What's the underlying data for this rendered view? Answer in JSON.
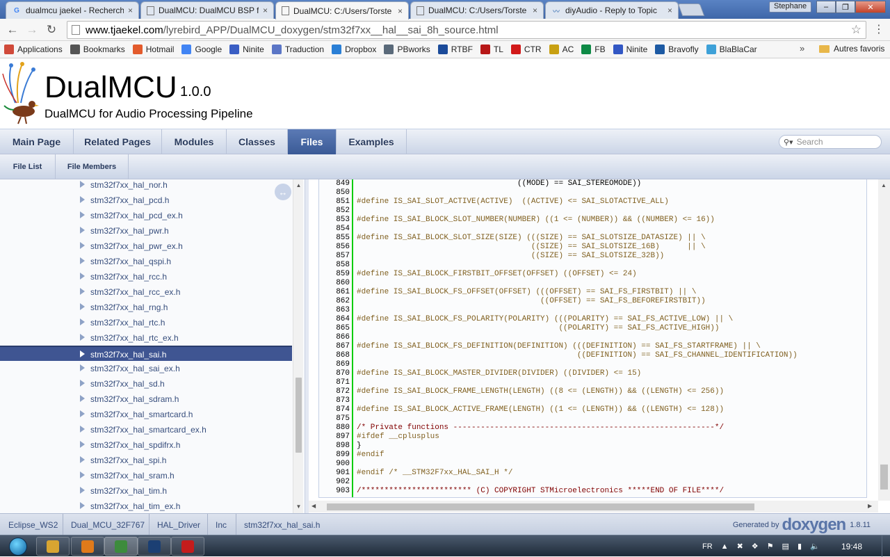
{
  "browser": {
    "tabs": [
      {
        "title": "dualmcu jaekel - Recherch",
        "favicon": "google-icon"
      },
      {
        "title": "DualMCU: DualMCU BSP f",
        "favicon": "page-icon"
      },
      {
        "title": "DualMCU: C:/Users/Torste",
        "favicon": "page-icon",
        "active": true
      },
      {
        "title": "DualMCU: C:/Users/Torste",
        "favicon": "page-icon"
      },
      {
        "title": "diyAudio - Reply to Topic",
        "favicon": "diyaudio-icon"
      }
    ],
    "user": "Stephane",
    "url_host": "www.tjaekel.com",
    "url_path": "/lyrebird_APP/DualMCU_doxygen/stm32f7xx__hal__sai_8h_source.html",
    "bookmarks": [
      {
        "label": "Applications",
        "icon": "apps-grid-icon",
        "color": "#d04a3a"
      },
      {
        "label": "Bookmarks",
        "icon": "star-icon",
        "color": "#555555"
      },
      {
        "label": "Hotmail",
        "icon": "windows-icon",
        "color": "#e35b2c"
      },
      {
        "label": "Google",
        "icon": "google-icon",
        "color": "#4285f4"
      },
      {
        "label": "Ninite",
        "icon": "ninite-icon",
        "color": "#3a5ec4"
      },
      {
        "label": "Traduction",
        "icon": "translate-icon",
        "color": "#5b76c6"
      },
      {
        "label": "Dropbox",
        "icon": "dropbox-icon",
        "color": "#2a7fd6"
      },
      {
        "label": "PBworks",
        "icon": "pb-icon",
        "color": "#5a6a7a"
      },
      {
        "label": "RTBF",
        "icon": "rtbf-icon",
        "color": "#1b4b9a"
      },
      {
        "label": "TL",
        "icon": "tl-icon",
        "color": "#b71818"
      },
      {
        "label": "CTR",
        "icon": "ctr-icon",
        "color": "#d11919"
      },
      {
        "label": "AC",
        "icon": "ac-icon",
        "color": "#c8a012"
      },
      {
        "label": "FB",
        "icon": "fb-icon",
        "color": "#0e8a46"
      },
      {
        "label": "Ninite",
        "icon": "n-icon",
        "color": "#3257c4"
      },
      {
        "label": "Bravofly",
        "icon": "bravofly-icon",
        "color": "#1d5aa3"
      },
      {
        "label": "BlaBlaCar",
        "icon": "blablacar-icon",
        "color": "#3ea1d8"
      }
    ],
    "bookmarks_more": "»",
    "other_bookmarks": "Autres favoris"
  },
  "header": {
    "project_name": "DualMCU",
    "project_version": "1.0.0",
    "project_brief": "DualMCU for Audio Processing Pipeline"
  },
  "main_tabs": [
    {
      "label": "Main Page"
    },
    {
      "label": "Related Pages"
    },
    {
      "label": "Modules"
    },
    {
      "label": "Classes"
    },
    {
      "label": "Files",
      "current": true
    },
    {
      "label": "Examples"
    }
  ],
  "search": {
    "placeholder": "Search"
  },
  "sub_tabs": [
    {
      "label": "File List"
    },
    {
      "label": "File Members"
    }
  ],
  "tree": [
    "stm32f7xx_hal_nor.h",
    "stm32f7xx_hal_pcd.h",
    "stm32f7xx_hal_pcd_ex.h",
    "stm32f7xx_hal_pwr.h",
    "stm32f7xx_hal_pwr_ex.h",
    "stm32f7xx_hal_qspi.h",
    "stm32f7xx_hal_rcc.h",
    "stm32f7xx_hal_rcc_ex.h",
    "stm32f7xx_hal_rng.h",
    "stm32f7xx_hal_rtc.h",
    "stm32f7xx_hal_rtc_ex.h",
    "stm32f7xx_hal_sai.h",
    "stm32f7xx_hal_sai_ex.h",
    "stm32f7xx_hal_sd.h",
    "stm32f7xx_hal_sdram.h",
    "stm32f7xx_hal_smartcard.h",
    "stm32f7xx_hal_smartcard_ex.h",
    "stm32f7xx_hal_spdifrx.h",
    "stm32f7xx_hal_spi.h",
    "stm32f7xx_hal_sram.h",
    "stm32f7xx_hal_tim.h",
    "stm32f7xx_hal_tim_ex.h"
  ],
  "tree_selected": "stm32f7xx_hal_sai.h",
  "code": [
    {
      "n": "849",
      "t": "                                   ((MODE) == SAI_STEREOMODE))",
      "k": ""
    },
    {
      "n": "850",
      "t": "",
      "k": ""
    },
    {
      "n": "851",
      "t": "#define IS_SAI_SLOT_ACTIVE(ACTIVE)  ((ACTIVE) <= SAI_SLOTACTIVE_ALL)",
      "k": "pp"
    },
    {
      "n": "852",
      "t": "",
      "k": ""
    },
    {
      "n": "853",
      "t": "#define IS_SAI_BLOCK_SLOT_NUMBER(NUMBER) ((1 <= (NUMBER)) && ((NUMBER) <= 16))",
      "k": "pp"
    },
    {
      "n": "854",
      "t": "",
      "k": ""
    },
    {
      "n": "855",
      "t": "#define IS_SAI_BLOCK_SLOT_SIZE(SIZE) (((SIZE) == SAI_SLOTSIZE_DATASIZE) || \\",
      "k": "pp"
    },
    {
      "n": "856",
      "t": "                                      ((SIZE) == SAI_SLOTSIZE_16B)      || \\",
      "k": "pp"
    },
    {
      "n": "857",
      "t": "                                      ((SIZE) == SAI_SLOTSIZE_32B))",
      "k": "pp"
    },
    {
      "n": "858",
      "t": "",
      "k": ""
    },
    {
      "n": "859",
      "t": "#define IS_SAI_BLOCK_FIRSTBIT_OFFSET(OFFSET) ((OFFSET) <= 24)",
      "k": "pp"
    },
    {
      "n": "860",
      "t": "",
      "k": ""
    },
    {
      "n": "861",
      "t": "#define IS_SAI_BLOCK_FS_OFFSET(OFFSET) (((OFFSET) == SAI_FS_FIRSTBIT) || \\",
      "k": "pp"
    },
    {
      "n": "862",
      "t": "                                        ((OFFSET) == SAI_FS_BEFOREFIRSTBIT))",
      "k": "pp"
    },
    {
      "n": "863",
      "t": "",
      "k": ""
    },
    {
      "n": "864",
      "t": "#define IS_SAI_BLOCK_FS_POLARITY(POLARITY) (((POLARITY) == SAI_FS_ACTIVE_LOW) || \\",
      "k": "pp"
    },
    {
      "n": "865",
      "t": "                                            ((POLARITY) == SAI_FS_ACTIVE_HIGH))",
      "k": "pp"
    },
    {
      "n": "866",
      "t": "",
      "k": ""
    },
    {
      "n": "867",
      "t": "#define IS_SAI_BLOCK_FS_DEFINITION(DEFINITION) (((DEFINITION) == SAI_FS_STARTFRAME) || \\",
      "k": "pp"
    },
    {
      "n": "868",
      "t": "                                                ((DEFINITION) == SAI_FS_CHANNEL_IDENTIFICATION))",
      "k": "pp"
    },
    {
      "n": "869",
      "t": "",
      "k": ""
    },
    {
      "n": "870",
      "t": "#define IS_SAI_BLOCK_MASTER_DIVIDER(DIVIDER) ((DIVIDER) <= 15)",
      "k": "pp"
    },
    {
      "n": "871",
      "t": "",
      "k": ""
    },
    {
      "n": "872",
      "t": "#define IS_SAI_BLOCK_FRAME_LENGTH(LENGTH) ((8 <= (LENGTH)) && ((LENGTH) <= 256))",
      "k": "pp"
    },
    {
      "n": "873",
      "t": "",
      "k": ""
    },
    {
      "n": "874",
      "t": "#define IS_SAI_BLOCK_ACTIVE_FRAME(LENGTH) ((1 <= (LENGTH)) && ((LENGTH) <= 128))",
      "k": "pp"
    },
    {
      "n": "875",
      "t": "",
      "k": ""
    },
    {
      "n": "880",
      "t": "/* Private functions ---------------------------------------------------------*/",
      "k": "cm"
    },
    {
      "n": "897",
      "t": "#ifdef __cplusplus",
      "k": "pp"
    },
    {
      "n": "898",
      "t": "}",
      "k": ""
    },
    {
      "n": "899",
      "t": "#endif",
      "k": "pp"
    },
    {
      "n": "900",
      "t": "",
      "k": ""
    },
    {
      "n": "901",
      "t": "#endif /* __STM32F7xx_HAL_SAI_H */",
      "k": "mix"
    },
    {
      "n": "902",
      "t": "",
      "k": ""
    },
    {
      "n": "903",
      "t": "/************************ (C) COPYRIGHT STMicroelectronics *****END OF FILE****/",
      "k": "cm"
    }
  ],
  "navpath": [
    "Eclipse_WS2",
    "Dual_MCU_32F767",
    "HAL_Driver",
    "Inc",
    "stm32f7xx_hal_sai.h"
  ],
  "footer": {
    "generated_by": "Generated by",
    "doxygen": "doxygen",
    "version": "1.8.11"
  },
  "taskbar": {
    "apps": [
      {
        "name": "explorer",
        "icon": "folder-icon",
        "color": "#d8a531"
      },
      {
        "name": "media",
        "icon": "play-icon",
        "color": "#e07a1a"
      },
      {
        "name": "chrome",
        "icon": "chrome-icon",
        "color": "#3d8b3d",
        "active": true
      },
      {
        "name": "photoshop",
        "icon": "ps-icon",
        "color": "#1b3f73"
      },
      {
        "name": "acrobat",
        "icon": "pdf-icon",
        "color": "#c41c1c"
      }
    ],
    "lang": "FR",
    "clock": "19:48"
  }
}
